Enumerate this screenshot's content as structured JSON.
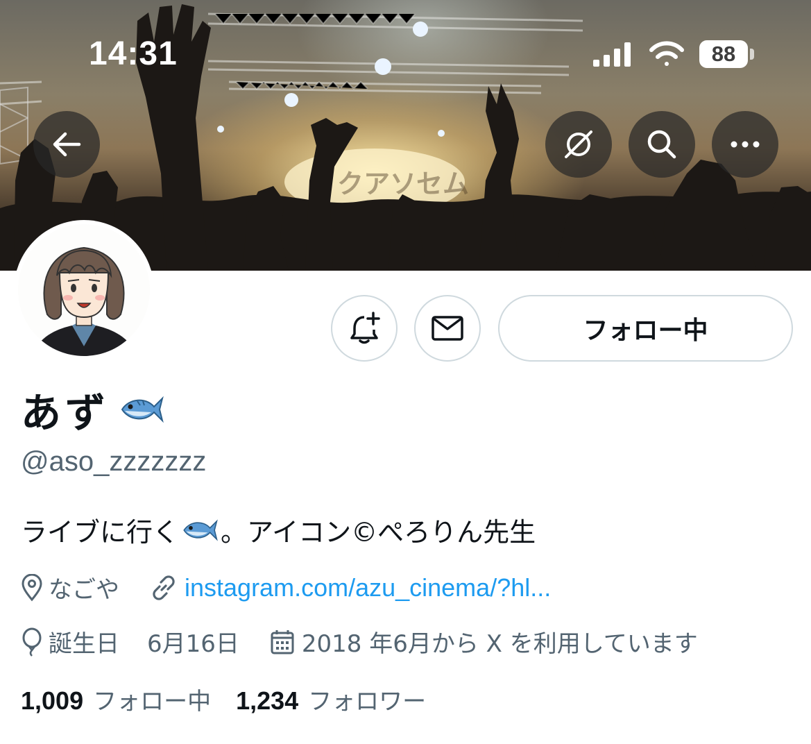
{
  "status_bar": {
    "time": "14:31",
    "battery": "88"
  },
  "banner": {
    "stage_text": "クアソセム"
  },
  "profile": {
    "display_name": "あず",
    "name_emoji": "fish-emoji",
    "handle": "@aso_zzzzzzz",
    "bio_before": "ライブに行く",
    "bio_after": "。アイコン©ぺろりん先生",
    "location": "なごや",
    "link": "instagram.com/azu_cinema/?hl...",
    "birthday_label": "誕生日",
    "birthday": "6月16日",
    "joined": "2018 年6月から X を利用しています"
  },
  "actions": {
    "follow_label": "フォロー中"
  },
  "stats": {
    "following_count": "1,009",
    "following_label": "フォロー中",
    "followers_count": "1,234",
    "followers_label": "フォロワー"
  },
  "icons": [
    "back-arrow-icon",
    "grok-icon",
    "search-icon",
    "more-icon",
    "notification-bell-icon",
    "mail-icon",
    "location-icon",
    "link-icon",
    "balloon-icon",
    "calendar-icon"
  ],
  "colors": {
    "link": "#1d9bf0",
    "secondary_text": "#536471",
    "border": "#cfd9de"
  }
}
